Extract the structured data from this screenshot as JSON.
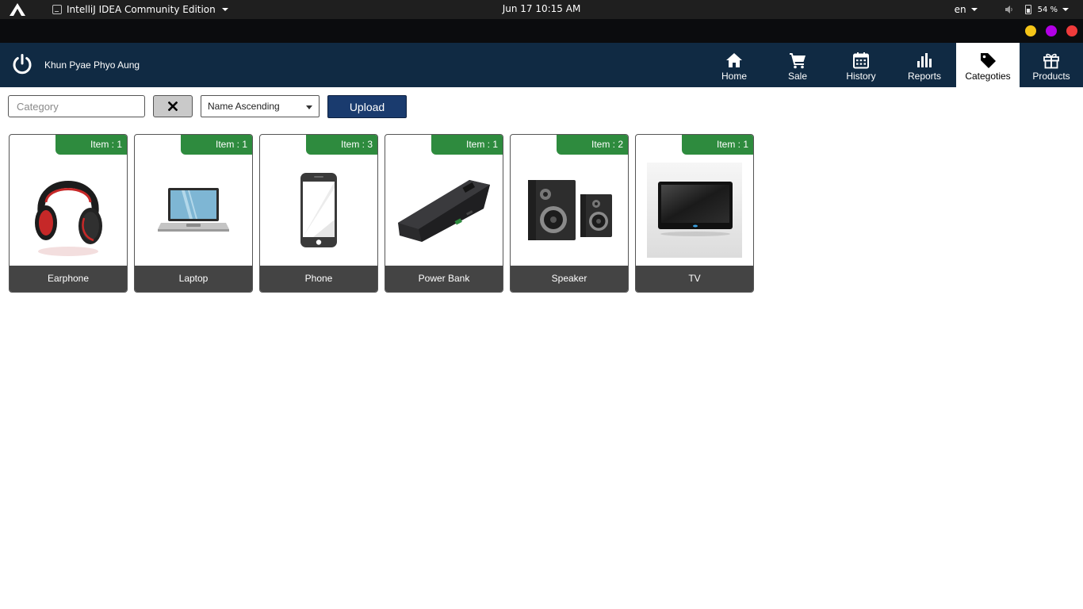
{
  "os": {
    "app_title": "IntelliJ IDEA Community Edition",
    "clock": "Jun 17  10:15 AM",
    "language": "en",
    "battery": "54 %"
  },
  "window": {
    "buttons": [
      {
        "name": "minimize",
        "color": "#f5c518"
      },
      {
        "name": "maximize",
        "color": "#b200e6"
      },
      {
        "name": "close",
        "color": "#ef3b3b"
      }
    ]
  },
  "header": {
    "user_name": "Khun Pyae Phyo Aung",
    "nav": [
      {
        "label": "Home",
        "icon": "home-icon"
      },
      {
        "label": "Sale",
        "icon": "cart-icon"
      },
      {
        "label": "History",
        "icon": "calendar-icon"
      },
      {
        "label": "Reports",
        "icon": "bar-chart-icon"
      },
      {
        "label": "Categoties",
        "icon": "tag-icon",
        "active": true
      },
      {
        "label": "Products",
        "icon": "gift-icon"
      }
    ]
  },
  "toolbar": {
    "search_placeholder": "Category",
    "clear_icon": "x-icon",
    "sort_selected": "Name Ascending",
    "upload_label": "Upload"
  },
  "categories": [
    {
      "name": "Earphone",
      "badge": "Item : 1",
      "icon": "headphones-image"
    },
    {
      "name": "Laptop",
      "badge": "Item : 1",
      "icon": "laptop-image"
    },
    {
      "name": "Phone",
      "badge": "Item : 3",
      "icon": "phone-image"
    },
    {
      "name": "Power Bank",
      "badge": "Item : 1",
      "icon": "power-bank-image"
    },
    {
      "name": "Speaker",
      "badge": "Item : 2",
      "icon": "speaker-image"
    },
    {
      "name": "TV",
      "badge": "Item : 1",
      "icon": "tv-image"
    }
  ],
  "colors": {
    "header_bg": "#102a43",
    "badge_green": "#2e8b3e",
    "card_label_bg": "#444444",
    "upload_button": "#1a3b6e"
  }
}
